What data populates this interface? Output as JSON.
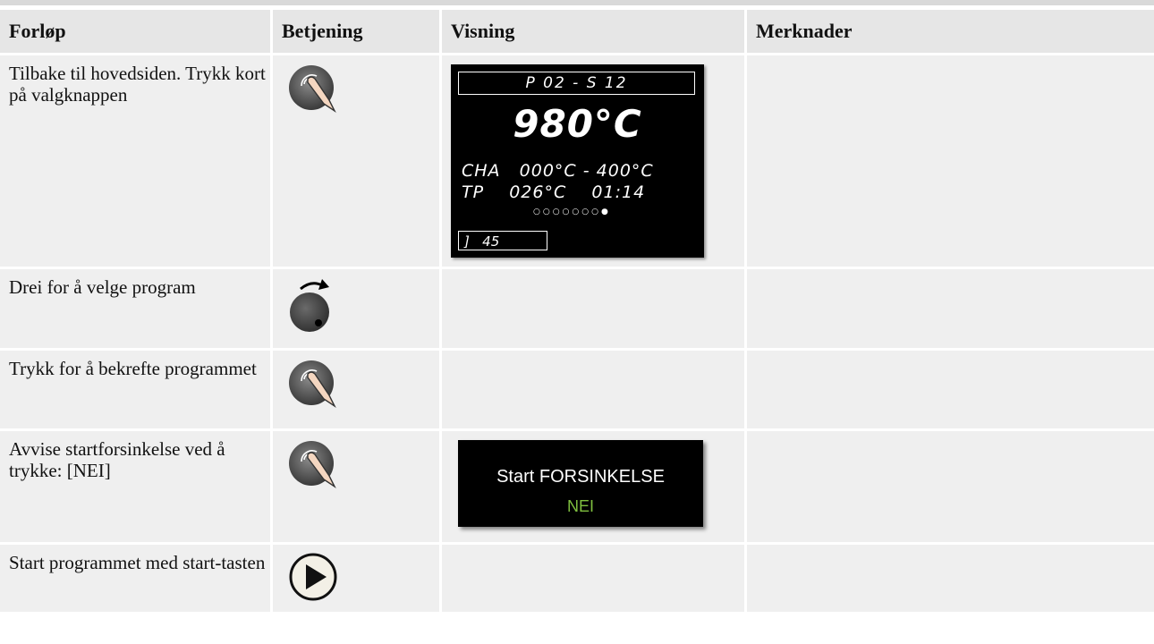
{
  "table": {
    "headers": [
      "Forløp",
      "Betjening",
      "Visning",
      "Merknader"
    ],
    "rows": [
      {
        "step": "Tilbake til hovedsiden. Trykk kort på valgknappen",
        "control": "press-knob-icon",
        "display": "main-screen",
        "note": ""
      },
      {
        "step": "Drei for å velge program",
        "control": "rotate-knob-icon",
        "display": "",
        "note": ""
      },
      {
        "step": "Trykk for å bekrefte programmet",
        "control": "press-knob-icon",
        "display": "",
        "note": ""
      },
      {
        "step": "Avvise startforsinkelse ved å trykke: [NEI]",
        "control": "press-knob-icon",
        "display": "start-delay-popup",
        "note": ""
      },
      {
        "step": "Start programmet med start-tasten",
        "control": "play-button-icon",
        "display": "",
        "note": ""
      }
    ]
  },
  "lcd": {
    "program_segment": "P 02 - S 12",
    "temperature": "980°C",
    "row1": "CHA   000°C - 400°C",
    "row2": "TP    026°C    01:14",
    "dots": "○○○○○○○●",
    "bottom": "]   45"
  },
  "popup": {
    "title": "Start FORSINKELSE",
    "value": "NEI",
    "value_color": "#7fbf3f"
  }
}
